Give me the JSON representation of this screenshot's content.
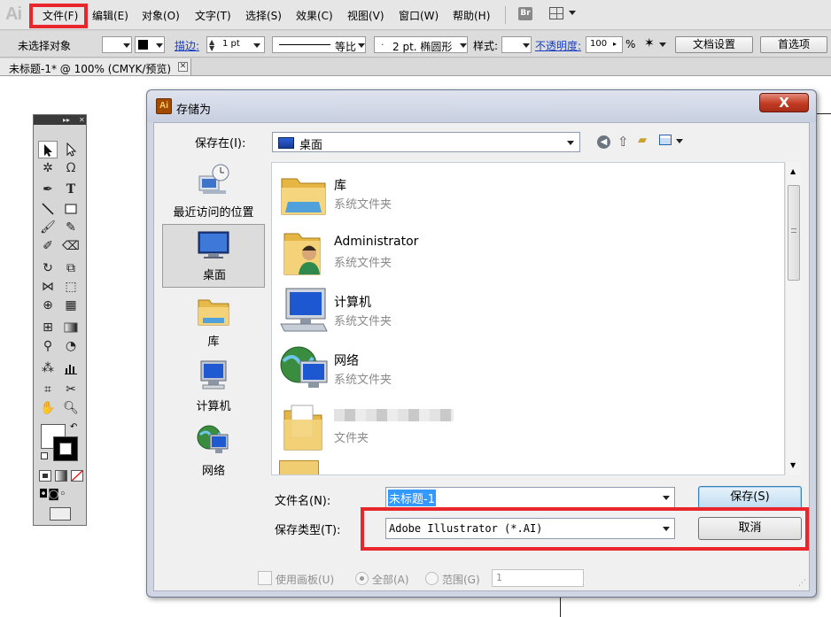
{
  "app": {
    "logo": "Ai"
  },
  "menu": {
    "items": [
      "文件(F)",
      "编辑(E)",
      "对象(O)",
      "文字(T)",
      "选择(S)",
      "效果(C)",
      "视图(V)",
      "窗口(W)",
      "帮助(H)"
    ],
    "bridge_label": "Br"
  },
  "control_bar": {
    "selection": "未选择对象",
    "stroke_label": "描边:",
    "stroke_weight": "1 pt",
    "profile_label": "等比",
    "brush_label": "2 pt. 椭圆形",
    "style_label": "样式:",
    "opacity_label": "不透明度:",
    "opacity_value": "100",
    "opacity_unit": "%",
    "doc_setup": "文档设置",
    "preferences": "首选项"
  },
  "document_tab": {
    "label": "未标题-1* @ 100% (CMYK/预览)",
    "close": "✕"
  },
  "dialog": {
    "title": "存储为",
    "close": "X",
    "save_in_label": "保存在(I):",
    "save_in_value": "桌面",
    "places": [
      {
        "label": "最近访问的位置",
        "icon": "recent-places-icon"
      },
      {
        "label": "桌面",
        "icon": "desktop-icon",
        "active": true
      },
      {
        "label": "库",
        "icon": "libraries-icon"
      },
      {
        "label": "计算机",
        "icon": "computer-icon"
      },
      {
        "label": "网络",
        "icon": "network-icon"
      }
    ],
    "files": [
      {
        "name": "库",
        "type": "系统文件夹",
        "icon": "libraries-icon"
      },
      {
        "name": "Administrator",
        "type": "系统文件夹",
        "icon": "user-folder-icon"
      },
      {
        "name": "计算机",
        "type": "系统文件夹",
        "icon": "computer-icon"
      },
      {
        "name": "网络",
        "type": "系统文件夹",
        "icon": "network-icon"
      },
      {
        "name": "",
        "type": "文件夹",
        "icon": "folder-icon",
        "blurred": true
      }
    ],
    "filename_label": "文件名(N):",
    "filename_value": "未标题-1",
    "filetype_label": "保存类型(T):",
    "filetype_value": "Adobe Illustrator (*.AI)",
    "save_button": "保存(S)",
    "cancel_button": "取消",
    "use_artboards_label": "使用画板(U)",
    "all_label": "全部(A)",
    "range_label": "范围(G)",
    "range_value": "1"
  },
  "colors": {
    "highlight": "#e8262c",
    "dialog_frame": "#cfd5e3",
    "link_blue": "#1a3fbf",
    "selection_blue": "#3399ff"
  }
}
